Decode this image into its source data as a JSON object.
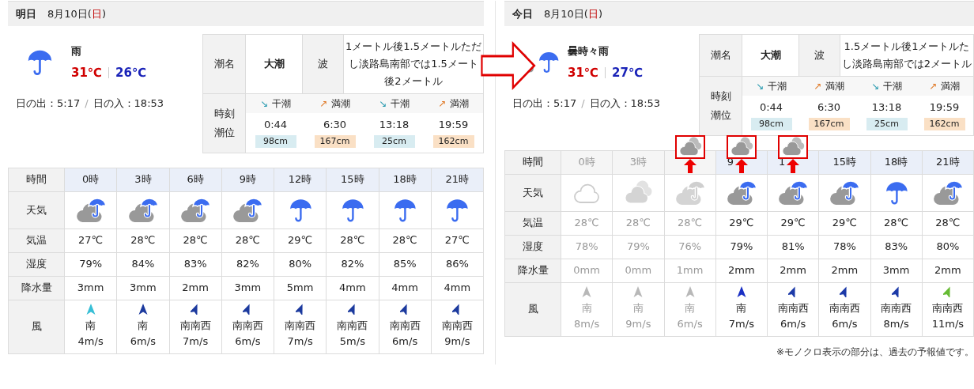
{
  "panels": [
    {
      "day": "明日",
      "date": {
        "before": "8月10日(",
        "weekday": "日",
        "after": ")"
      },
      "summary": {
        "kind": "rain",
        "weather": "雨",
        "high": "31℃",
        "low": "26℃",
        "sunrise": "日の出：5:17",
        "separator": "/",
        "sunset": "日の入：18:53"
      },
      "tide": {
        "name_label": "潮名",
        "name": "大潮",
        "wave_label": "波",
        "wave_lines": [
          "1メートル後1.5メートルただ",
          "し淡路島南部では1.5メート",
          "後2メートル"
        ],
        "time_label_lines": [
          "時刻",
          "潮位"
        ],
        "points": [
          {
            "kind": "low",
            "arrow": "↘",
            "label": "干潮",
            "time": "0:44",
            "height": "98cm"
          },
          {
            "kind": "high",
            "arrow": "↗",
            "label": "満潮",
            "time": "6:30",
            "height": "167cm"
          },
          {
            "kind": "low",
            "arrow": "↘",
            "label": "干潮",
            "time": "13:18",
            "height": "25cm"
          },
          {
            "kind": "high",
            "arrow": "↗",
            "label": "満潮",
            "time": "19:59",
            "height": "162cm"
          }
        ]
      },
      "table": {
        "row_labels": [
          "時間",
          "天気",
          "気温",
          "湿度",
          "降水量",
          "風"
        ],
        "columns": [
          {
            "hour": "0時",
            "past": false,
            "kind": "rain_cloud",
            "temp": "27℃",
            "humidity": "79%",
            "precip": "3mm",
            "wind": {
              "kind": "south",
              "color": "#38bfd6",
              "direction": "南",
              "speed": "4m/s"
            }
          },
          {
            "hour": "3時",
            "past": false,
            "kind": "rain_cloud",
            "temp": "28℃",
            "humidity": "84%",
            "precip": "3mm",
            "wind": {
              "kind": "south",
              "color": "#1c3a9e",
              "direction": "南",
              "speed": "6m/s"
            }
          },
          {
            "hour": "6時",
            "past": false,
            "kind": "rain_cloud",
            "temp": "28℃",
            "humidity": "83%",
            "precip": "2mm",
            "wind": {
              "kind": "south-southwest",
              "color": "#1c3a9e",
              "direction": "南南西",
              "speed": "7m/s"
            }
          },
          {
            "hour": "9時",
            "past": false,
            "kind": "rain_cloud",
            "temp": "28℃",
            "humidity": "82%",
            "precip": "3mm",
            "wind": {
              "kind": "south-southwest",
              "color": "#1c3a9e",
              "direction": "南南西",
              "speed": "6m/s"
            }
          },
          {
            "hour": "12時",
            "past": false,
            "kind": "rain",
            "temp": "29℃",
            "humidity": "80%",
            "precip": "5mm",
            "wind": {
              "kind": "south-southwest",
              "color": "#1c3a9e",
              "direction": "南南西",
              "speed": "7m/s"
            }
          },
          {
            "hour": "15時",
            "past": false,
            "kind": "rain",
            "temp": "28℃",
            "humidity": "82%",
            "precip": "4mm",
            "wind": {
              "kind": "south-southwest",
              "color": "#1c3a9e",
              "direction": "南南西",
              "speed": "5m/s"
            }
          },
          {
            "hour": "18時",
            "past": false,
            "kind": "rain",
            "temp": "28℃",
            "humidity": "85%",
            "precip": "4mm",
            "wind": {
              "kind": "south-southwest",
              "color": "#1c3a9e",
              "direction": "南南西",
              "speed": "6m/s"
            }
          },
          {
            "hour": "21時",
            "past": false,
            "kind": "rain",
            "temp": "27℃",
            "humidity": "86%",
            "precip": "4mm",
            "wind": {
              "kind": "south-southwest",
              "color": "#1c3a9e",
              "direction": "南南西",
              "speed": "9m/s"
            }
          }
        ]
      }
    },
    {
      "day": "今日",
      "date": {
        "before": "8月10日(",
        "weekday": "日",
        "after": ")"
      },
      "summary": {
        "kind": "cloud_then_rain",
        "weather": "曇時々雨",
        "high": "31℃",
        "low": "27℃",
        "sunrise": "日の出：5:17",
        "separator": "/",
        "sunset": "日の入：18:53"
      },
      "tide": {
        "name_label": "潮名",
        "name": "大潮",
        "wave_label": "波",
        "wave_lines": [
          "1.5メートル後1メートルた",
          "し淡路島南部では2メートル"
        ],
        "time_label_lines": [
          "時刻",
          "潮位"
        ],
        "points": [
          {
            "kind": "low",
            "arrow": "↘",
            "label": "干潮",
            "time": "0:44",
            "height": "98cm"
          },
          {
            "kind": "high",
            "arrow": "↗",
            "label": "満潮",
            "time": "6:30",
            "height": "167cm"
          },
          {
            "kind": "low",
            "arrow": "↘",
            "label": "干潮",
            "time": "13:18",
            "height": "25cm"
          },
          {
            "kind": "high",
            "arrow": "↗",
            "label": "満潮",
            "time": "19:59",
            "height": "162cm"
          }
        ]
      },
      "table": {
        "row_labels": [
          "時間",
          "天気",
          "気温",
          "湿度",
          "降水量",
          "風"
        ],
        "columns": [
          {
            "hour": "0時",
            "past": true,
            "callout": false,
            "kind": "cloud",
            "temp": "28℃",
            "humidity": "78%",
            "precip": "0mm",
            "wind": {
              "kind": "south",
              "color": "#b8b8b8",
              "direction": "南",
              "speed": "8m/s"
            }
          },
          {
            "hour": "3時",
            "past": true,
            "callout": false,
            "kind": "cloudy",
            "temp": "28℃",
            "humidity": "79%",
            "precip": "0mm",
            "wind": {
              "kind": "south",
              "color": "#b8b8b8",
              "direction": "南",
              "speed": "9m/s"
            }
          },
          {
            "past": true,
            "callout": true,
            "kind": "rain_cloud",
            "temp": "28℃",
            "humidity": "76%",
            "precip": "1mm",
            "wind": {
              "kind": "south",
              "color": "#b8b8b8",
              "direction": "南",
              "speed": "6m/s"
            }
          },
          {
            "hour": "9",
            "past": false,
            "callout": true,
            "kind": "rain_cloud",
            "temp": "29℃",
            "humidity": "79%",
            "precip": "2mm",
            "wind": {
              "kind": "south",
              "color": "#1a2fc4",
              "direction": "南",
              "speed": "7m/s"
            }
          },
          {
            "hour": "1",
            "past": false,
            "callout": true,
            "kind": "rain_cloud",
            "temp": "29℃",
            "humidity": "81%",
            "precip": "2mm",
            "wind": {
              "kind": "south-southwest",
              "color": "#1c3aa8",
              "direction": "南南西",
              "speed": "6m/s"
            }
          },
          {
            "hour": "15時",
            "past": false,
            "callout": false,
            "kind": "rain_cloud",
            "temp": "29℃",
            "humidity": "78%",
            "precip": "2mm",
            "wind": {
              "kind": "south-southwest",
              "color": "#1c3aa8",
              "direction": "南南西",
              "speed": "6m/s"
            }
          },
          {
            "hour": "18時",
            "past": false,
            "callout": false,
            "kind": "rain",
            "temp": "28℃",
            "humidity": "83%",
            "precip": "3mm",
            "wind": {
              "kind": "south-southwest",
              "color": "#1c3aa8",
              "direction": "南南西",
              "speed": "8m/s"
            }
          },
          {
            "hour": "21時",
            "past": false,
            "callout": false,
            "kind": "rain_cloud",
            "temp": "28℃",
            "humidity": "80%",
            "precip": "2mm",
            "wind": {
              "kind": "south-southwest",
              "color": "#66bb33",
              "direction": "南南西",
              "speed": "11m/s"
            }
          }
        ]
      },
      "note": "※モノクロ表示の部分は、過去の予報値です。"
    }
  ]
}
